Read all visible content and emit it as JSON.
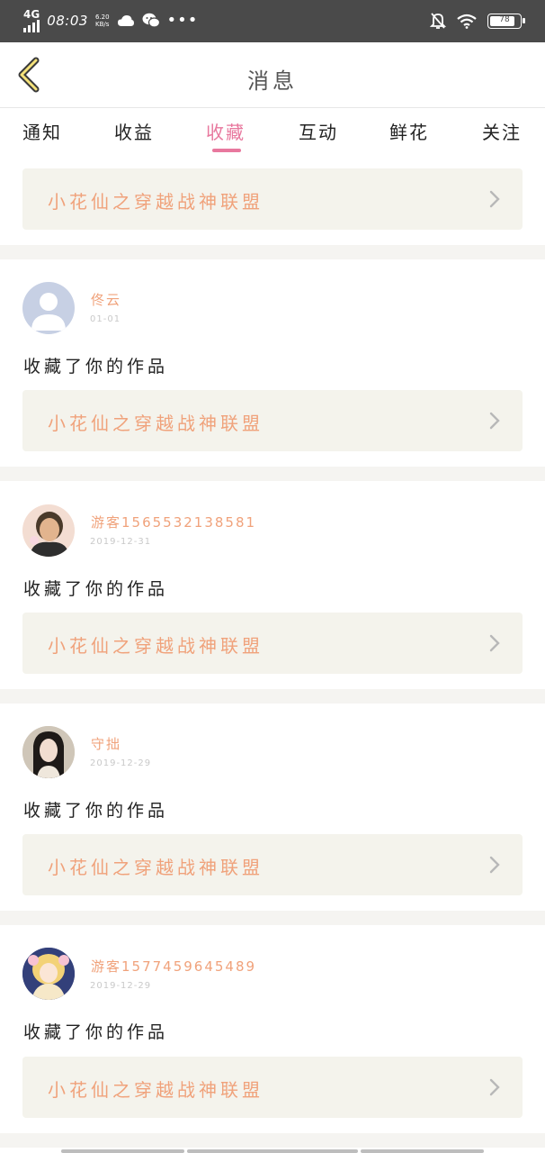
{
  "status_bar": {
    "network": "4G",
    "time": "08:03",
    "speed_value": "6.20",
    "speed_unit": "KB/s",
    "weather_icon": "cloud-icon",
    "app_icon": "wechat-icon",
    "more": "•••",
    "battery": "78"
  },
  "header": {
    "title": "消息"
  },
  "tabs": [
    {
      "label": "通知",
      "active": false
    },
    {
      "label": "收益",
      "active": false
    },
    {
      "label": "收藏",
      "active": true
    },
    {
      "label": "互动",
      "active": false
    },
    {
      "label": "鲜花",
      "active": false
    },
    {
      "label": "关注",
      "active": false
    }
  ],
  "top_card": {
    "work_title": "小花仙之穿越战神联盟"
  },
  "items": [
    {
      "username": "佟云",
      "date": "01-01",
      "action": "收藏了你的作品",
      "work_title": "小花仙之穿越战神联盟",
      "avatar": "default-avatar"
    },
    {
      "username": "游客1565532138581",
      "date": "2019-12-31",
      "action": "收藏了你的作品",
      "work_title": "小花仙之穿越战神联盟",
      "avatar": "photo-avatar"
    },
    {
      "username": "守拙",
      "date": "2019-12-29",
      "action": "收藏了你的作品",
      "work_title": "小花仙之穿越战神联盟",
      "avatar": "girl-avatar"
    },
    {
      "username": "游客1577459645489",
      "date": "2019-12-29",
      "action": "收藏了你的作品",
      "work_title": "小花仙之穿越战神联盟",
      "avatar": "anime-avatar"
    }
  ],
  "colors": {
    "accent": "#e8789e",
    "work_title": "#f0a27b",
    "card_bg": "#f4f3ec",
    "status_bar": "#4a4a4a"
  }
}
